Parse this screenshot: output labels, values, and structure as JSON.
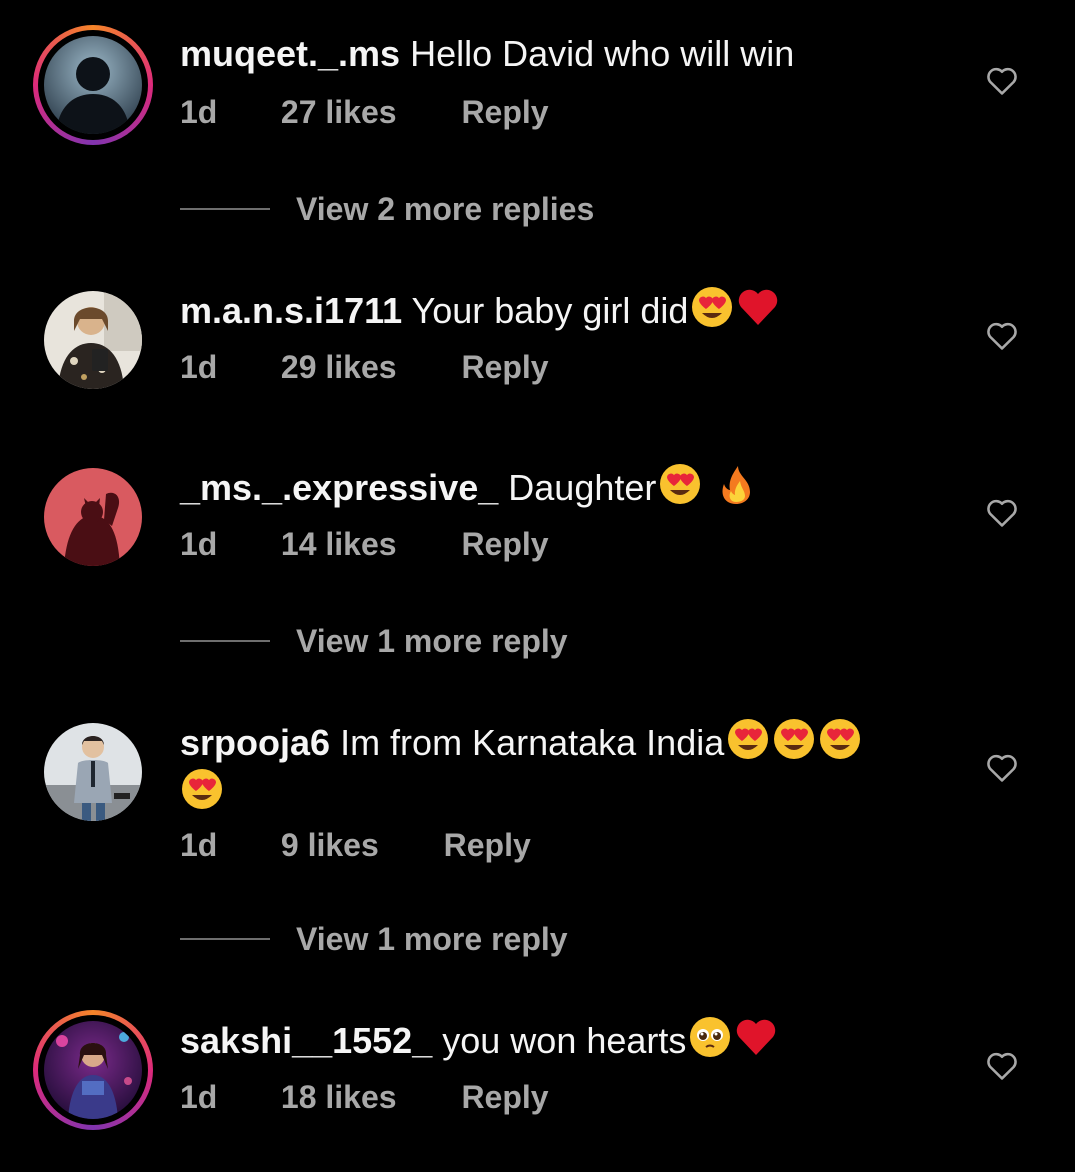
{
  "comments": [
    {
      "username": "muqeet._.ms",
      "text": "Hello David who will win",
      "time": "1d",
      "likes": "27 likes",
      "reply": "Reply",
      "view_replies": "View 2 more replies"
    },
    {
      "username": "m.a.n.s.i1711",
      "text": "Your baby girl did",
      "time": "1d",
      "likes": "29 likes",
      "reply": "Reply"
    },
    {
      "username": "_ms._.expressive_",
      "text": "Daughter",
      "time": "1d",
      "likes": "14 likes",
      "reply": "Reply",
      "view_replies": "View 1 more reply"
    },
    {
      "username": "srpooja6",
      "text": "Im from Karnataka India",
      "time": "1d",
      "likes": "9 likes",
      "reply": "Reply",
      "view_replies": "View 1 more reply"
    },
    {
      "username": "sakshi__1552_",
      "text": "you won hearts",
      "time": "1d",
      "likes": "18 likes",
      "reply": "Reply"
    }
  ],
  "icons": {
    "like": "heart-outline-icon",
    "heart_eyes": "heart-eyes-emoji",
    "red_heart": "red-heart-emoji",
    "fire": "fire-emoji",
    "pleading": "pleading-face-emoji"
  },
  "colors": {
    "background": "#000000",
    "primary_text": "#f5f5f5",
    "secondary_text": "#a8a8a8",
    "story_ring": "#dd2a7b"
  }
}
